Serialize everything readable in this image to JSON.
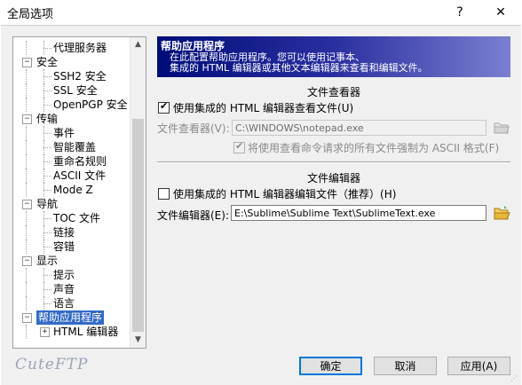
{
  "window": {
    "title": "全局选项",
    "help_glyph": "?",
    "close_glyph": "✕"
  },
  "tree": {
    "items": [
      {
        "label": "代理服务器",
        "level": 2,
        "toggle": ""
      },
      {
        "label": "安全",
        "level": 1,
        "toggle": "−"
      },
      {
        "label": "SSH2 安全",
        "level": 2,
        "toggle": ""
      },
      {
        "label": "SSL 安全",
        "level": 2,
        "toggle": ""
      },
      {
        "label": "OpenPGP 安全",
        "level": 2,
        "toggle": ""
      },
      {
        "label": "传输",
        "level": 1,
        "toggle": "−"
      },
      {
        "label": "事件",
        "level": 2,
        "toggle": ""
      },
      {
        "label": "智能覆盖",
        "level": 2,
        "toggle": ""
      },
      {
        "label": "重命名规则",
        "level": 2,
        "toggle": ""
      },
      {
        "label": "ASCII 文件",
        "level": 2,
        "toggle": ""
      },
      {
        "label": "Mode Z",
        "level": 2,
        "toggle": ""
      },
      {
        "label": "导航",
        "level": 1,
        "toggle": "−"
      },
      {
        "label": "TOC 文件",
        "level": 2,
        "toggle": ""
      },
      {
        "label": "链接",
        "level": 2,
        "toggle": ""
      },
      {
        "label": "容错",
        "level": 2,
        "toggle": ""
      },
      {
        "label": "显示",
        "level": 1,
        "toggle": "−"
      },
      {
        "label": "提示",
        "level": 2,
        "toggle": ""
      },
      {
        "label": "声音",
        "level": 2,
        "toggle": ""
      },
      {
        "label": "语言",
        "level": 2,
        "toggle": ""
      },
      {
        "label": "帮助应用程序",
        "level": 1,
        "toggle": "−",
        "selected": true
      },
      {
        "label": "HTML 编辑器",
        "level": 2,
        "toggle": "+"
      }
    ],
    "scroll_up": "▲",
    "scroll_down": "▼"
  },
  "header": {
    "title": "帮助应用程序",
    "line1": "在此配置帮助应用程序。您可以使用记事本、",
    "line2": "集成的 HTML 编辑器或其他文本编辑器来查看和编辑文件。"
  },
  "viewer": {
    "section_title": "文件查看器",
    "checkbox_label": "使用集成的 HTML 编辑器查看文件(U)",
    "checkbox_checked": true,
    "field_label": "文件查看器(V):",
    "field_value": "C:\\WINDOWS\\notepad.exe",
    "ascii_label": "将使用查看命令请求的所有文件强制为 ASCII 格式(F)",
    "ascii_checked": true
  },
  "editor": {
    "section_title": "文件编辑器",
    "checkbox_label": "使用集成的 HTML 编辑器编辑文件（推荐）(H)",
    "checkbox_checked": false,
    "field_label": "文件编辑器(E):",
    "field_value": "E:\\Sublime\\Sublime Text\\SublimeText.exe"
  },
  "buttons": {
    "ok": "确定",
    "cancel": "取消",
    "apply": "应用(A)"
  },
  "logo": "CuteFTP",
  "colors": {
    "selection": "#3169c6",
    "header_start": "#000c7a",
    "header_end": "#7b7fd0",
    "folder": "#e8b73a"
  }
}
